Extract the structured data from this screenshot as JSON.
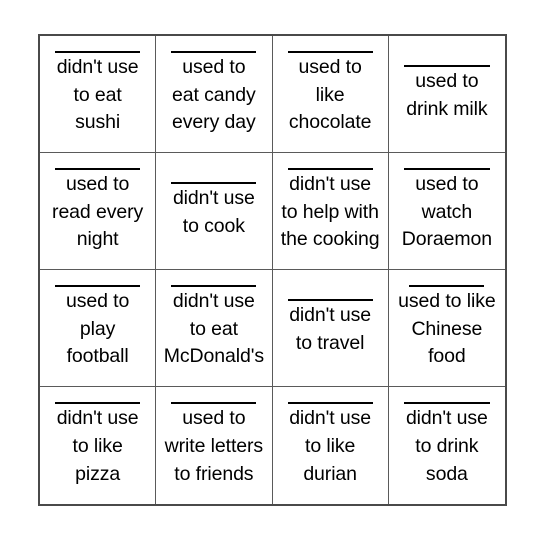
{
  "card": {
    "type": "bingo-card",
    "columns": 4,
    "rows": 4,
    "border_color": "#4a4a4a",
    "grid_line_color": "#5a5a5a",
    "text_color": "#000000",
    "rule_color": "#000000",
    "background": "#ffffff",
    "cells": [
      {
        "text": "didn't use\nto eat\nsushi",
        "rule": "long"
      },
      {
        "text": "used to\neat candy\nevery day",
        "rule": "long"
      },
      {
        "text": "used to\nlike\nchocolate",
        "rule": "long"
      },
      {
        "text": "used to\ndrink milk",
        "rule": "long"
      },
      {
        "text": "used to\nread every\nnight",
        "rule": "long"
      },
      {
        "text": "didn't use\nto cook",
        "rule": "long"
      },
      {
        "text": "didn't use\nto help with\nthe cooking",
        "rule": "long"
      },
      {
        "text": "used to\nwatch\nDoraemon",
        "rule": "long"
      },
      {
        "text": "used to\nplay\nfootball",
        "rule": "long"
      },
      {
        "text": "didn't use\nto eat\nMcDonald's",
        "rule": "long"
      },
      {
        "text": "didn't use\nto travel",
        "rule": "long"
      },
      {
        "text": "used to like\nChinese\nfood",
        "rule": "short"
      },
      {
        "text": "didn't use\nto like\npizza",
        "rule": "long"
      },
      {
        "text": "used to\nwrite letters\nto friends",
        "rule": "long"
      },
      {
        "text": "didn't use\nto like\ndurian",
        "rule": "long"
      },
      {
        "text": "didn't use\nto drink\nsoda",
        "rule": "long"
      }
    ]
  }
}
